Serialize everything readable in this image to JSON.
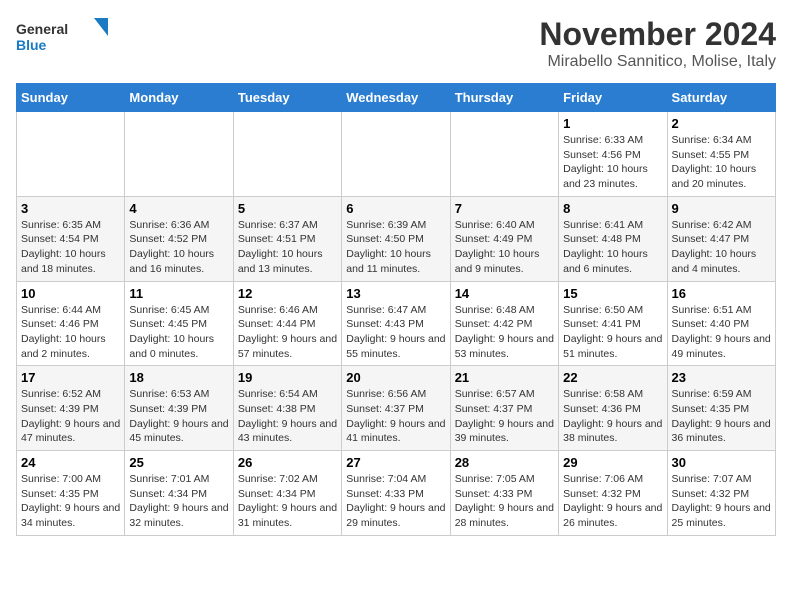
{
  "logo": {
    "line1": "General",
    "line2": "Blue"
  },
  "title": "November 2024",
  "location": "Mirabello Sannitico, Molise, Italy",
  "weekdays": [
    "Sunday",
    "Monday",
    "Tuesday",
    "Wednesday",
    "Thursday",
    "Friday",
    "Saturday"
  ],
  "weeks": [
    [
      {
        "day": "",
        "info": ""
      },
      {
        "day": "",
        "info": ""
      },
      {
        "day": "",
        "info": ""
      },
      {
        "day": "",
        "info": ""
      },
      {
        "day": "",
        "info": ""
      },
      {
        "day": "1",
        "info": "Sunrise: 6:33 AM\nSunset: 4:56 PM\nDaylight: 10 hours and 23 minutes."
      },
      {
        "day": "2",
        "info": "Sunrise: 6:34 AM\nSunset: 4:55 PM\nDaylight: 10 hours and 20 minutes."
      }
    ],
    [
      {
        "day": "3",
        "info": "Sunrise: 6:35 AM\nSunset: 4:54 PM\nDaylight: 10 hours and 18 minutes."
      },
      {
        "day": "4",
        "info": "Sunrise: 6:36 AM\nSunset: 4:52 PM\nDaylight: 10 hours and 16 minutes."
      },
      {
        "day": "5",
        "info": "Sunrise: 6:37 AM\nSunset: 4:51 PM\nDaylight: 10 hours and 13 minutes."
      },
      {
        "day": "6",
        "info": "Sunrise: 6:39 AM\nSunset: 4:50 PM\nDaylight: 10 hours and 11 minutes."
      },
      {
        "day": "7",
        "info": "Sunrise: 6:40 AM\nSunset: 4:49 PM\nDaylight: 10 hours and 9 minutes."
      },
      {
        "day": "8",
        "info": "Sunrise: 6:41 AM\nSunset: 4:48 PM\nDaylight: 10 hours and 6 minutes."
      },
      {
        "day": "9",
        "info": "Sunrise: 6:42 AM\nSunset: 4:47 PM\nDaylight: 10 hours and 4 minutes."
      }
    ],
    [
      {
        "day": "10",
        "info": "Sunrise: 6:44 AM\nSunset: 4:46 PM\nDaylight: 10 hours and 2 minutes."
      },
      {
        "day": "11",
        "info": "Sunrise: 6:45 AM\nSunset: 4:45 PM\nDaylight: 10 hours and 0 minutes."
      },
      {
        "day": "12",
        "info": "Sunrise: 6:46 AM\nSunset: 4:44 PM\nDaylight: 9 hours and 57 minutes."
      },
      {
        "day": "13",
        "info": "Sunrise: 6:47 AM\nSunset: 4:43 PM\nDaylight: 9 hours and 55 minutes."
      },
      {
        "day": "14",
        "info": "Sunrise: 6:48 AM\nSunset: 4:42 PM\nDaylight: 9 hours and 53 minutes."
      },
      {
        "day": "15",
        "info": "Sunrise: 6:50 AM\nSunset: 4:41 PM\nDaylight: 9 hours and 51 minutes."
      },
      {
        "day": "16",
        "info": "Sunrise: 6:51 AM\nSunset: 4:40 PM\nDaylight: 9 hours and 49 minutes."
      }
    ],
    [
      {
        "day": "17",
        "info": "Sunrise: 6:52 AM\nSunset: 4:39 PM\nDaylight: 9 hours and 47 minutes."
      },
      {
        "day": "18",
        "info": "Sunrise: 6:53 AM\nSunset: 4:39 PM\nDaylight: 9 hours and 45 minutes."
      },
      {
        "day": "19",
        "info": "Sunrise: 6:54 AM\nSunset: 4:38 PM\nDaylight: 9 hours and 43 minutes."
      },
      {
        "day": "20",
        "info": "Sunrise: 6:56 AM\nSunset: 4:37 PM\nDaylight: 9 hours and 41 minutes."
      },
      {
        "day": "21",
        "info": "Sunrise: 6:57 AM\nSunset: 4:37 PM\nDaylight: 9 hours and 39 minutes."
      },
      {
        "day": "22",
        "info": "Sunrise: 6:58 AM\nSunset: 4:36 PM\nDaylight: 9 hours and 38 minutes."
      },
      {
        "day": "23",
        "info": "Sunrise: 6:59 AM\nSunset: 4:35 PM\nDaylight: 9 hours and 36 minutes."
      }
    ],
    [
      {
        "day": "24",
        "info": "Sunrise: 7:00 AM\nSunset: 4:35 PM\nDaylight: 9 hours and 34 minutes."
      },
      {
        "day": "25",
        "info": "Sunrise: 7:01 AM\nSunset: 4:34 PM\nDaylight: 9 hours and 32 minutes."
      },
      {
        "day": "26",
        "info": "Sunrise: 7:02 AM\nSunset: 4:34 PM\nDaylight: 9 hours and 31 minutes."
      },
      {
        "day": "27",
        "info": "Sunrise: 7:04 AM\nSunset: 4:33 PM\nDaylight: 9 hours and 29 minutes."
      },
      {
        "day": "28",
        "info": "Sunrise: 7:05 AM\nSunset: 4:33 PM\nDaylight: 9 hours and 28 minutes."
      },
      {
        "day": "29",
        "info": "Sunrise: 7:06 AM\nSunset: 4:32 PM\nDaylight: 9 hours and 26 minutes."
      },
      {
        "day": "30",
        "info": "Sunrise: 7:07 AM\nSunset: 4:32 PM\nDaylight: 9 hours and 25 minutes."
      }
    ]
  ]
}
